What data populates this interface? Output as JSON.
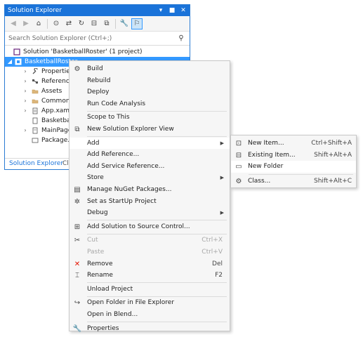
{
  "solution_explorer": {
    "title": "Solution Explorer",
    "title_buttons": [
      "▾",
      "■",
      "✕"
    ],
    "search_placeholder": "Search Solution Explorer (Ctrl+;)",
    "tree": [
      {
        "label": "Solution 'BasketballRoster' (1 project)",
        "expander": ""
      },
      {
        "label": "BasketballRoster",
        "expander": "◢",
        "selected": true
      },
      {
        "label": "Properties",
        "expander": "›"
      },
      {
        "label": "References",
        "expander": "›"
      },
      {
        "label": "Assets",
        "expander": "›"
      },
      {
        "label": "Common",
        "expander": "›"
      },
      {
        "label": "App.xaml",
        "expander": "›"
      },
      {
        "label": "BasketballRoster",
        "expander": ""
      },
      {
        "label": "MainPage",
        "expander": "›"
      },
      {
        "label": "Package.appxmanifest",
        "expander": ""
      }
    ],
    "tabs": [
      "Solution Explorer",
      "Cla"
    ]
  },
  "context_menu": {
    "items": [
      {
        "label": "Build",
        "icon": "build-icon",
        "glyph": "⚙"
      },
      {
        "label": "Rebuild"
      },
      {
        "label": "Deploy"
      },
      {
        "label": "Run Code Analysis"
      },
      {
        "sep": true
      },
      {
        "label": "Scope to This"
      },
      {
        "label": "New Solution Explorer View",
        "icon": "new-view-icon",
        "glyph": "⧉"
      },
      {
        "sep": true
      },
      {
        "label": "Add",
        "arrow": true,
        "highlight": true
      },
      {
        "label": "Add Reference..."
      },
      {
        "label": "Add Service Reference..."
      },
      {
        "label": "Store",
        "arrow": true
      },
      {
        "label": "Manage NuGet Packages...",
        "icon": "nuget-icon",
        "glyph": "▤"
      },
      {
        "label": "Set as StartUp Project",
        "icon": "gear-icon",
        "glyph": "✲"
      },
      {
        "label": "Debug",
        "arrow": true
      },
      {
        "sep": true
      },
      {
        "label": "Add Solution to Source Control...",
        "icon": "source-control-icon",
        "glyph": "⊞"
      },
      {
        "sep": true
      },
      {
        "label": "Cut",
        "shortcut": "Ctrl+X",
        "icon": "scissors-icon",
        "glyph": "✂",
        "disabled": true
      },
      {
        "label": "Paste",
        "shortcut": "Ctrl+V",
        "disabled": true
      },
      {
        "label": "Remove",
        "shortcut": "Del",
        "icon": "remove-icon",
        "glyph": "✕",
        "color": "#e51400"
      },
      {
        "label": "Rename",
        "shortcut": "F2",
        "icon": "rename-icon",
        "glyph": "⌶"
      },
      {
        "sep": true
      },
      {
        "label": "Unload Project"
      },
      {
        "sep": true
      },
      {
        "label": "Open Folder in File Explorer",
        "icon": "open-folder-icon",
        "glyph": "↪"
      },
      {
        "label": "Open in Blend..."
      },
      {
        "sep": true
      },
      {
        "label": "Properties",
        "icon": "wrench-icon",
        "glyph": "🔧"
      }
    ]
  },
  "submenu": {
    "items": [
      {
        "label": "New Item...",
        "shortcut": "Ctrl+Shift+A",
        "icon": "new-item-icon",
        "glyph": "⊡"
      },
      {
        "label": "Existing Item...",
        "shortcut": "Shift+Alt+A",
        "icon": "existing-item-icon",
        "glyph": "⊟"
      },
      {
        "label": "New Folder",
        "icon": "new-folder-icon",
        "glyph": "▭",
        "highlight": true
      },
      {
        "sep": true
      },
      {
        "label": "Class...",
        "shortcut": "Shift+Alt+C",
        "icon": "class-icon",
        "glyph": "⚙"
      }
    ]
  },
  "colors": {
    "accent": "#1a73d9",
    "selection": "#3399ff",
    "remove": "#e51400"
  }
}
